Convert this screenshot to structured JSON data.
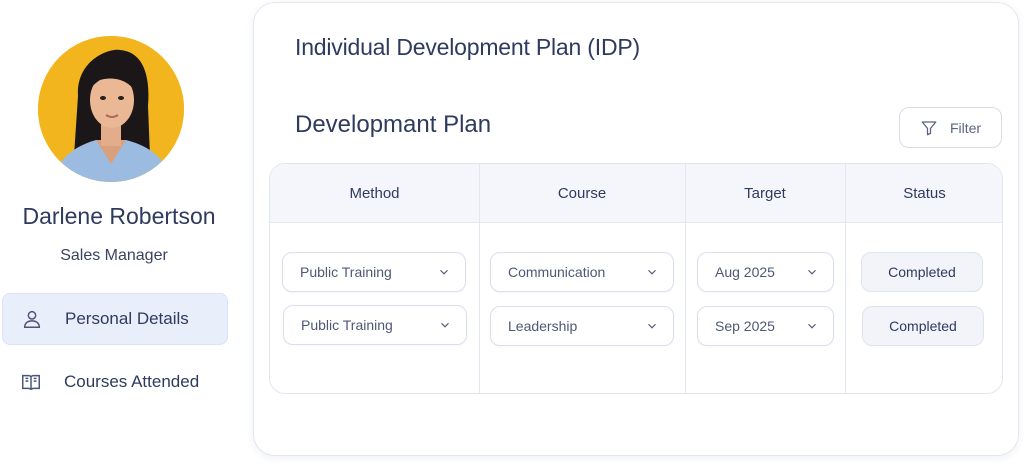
{
  "profile": {
    "name": "Darlene Robertson",
    "role": "Sales Manager"
  },
  "nav": {
    "items": [
      {
        "label": "Personal Details",
        "icon": "user-icon",
        "active": true
      },
      {
        "label": "Courses Attended",
        "icon": "book-icon",
        "active": false
      }
    ]
  },
  "card": {
    "title": "Individual Development Plan (IDP)",
    "section_title": "Developmant Plan",
    "filter_label": "Filter"
  },
  "table": {
    "headers": [
      "Method",
      "Course",
      "Target",
      "Status"
    ],
    "rows": [
      {
        "method": "Public Training",
        "course": "Communication",
        "target": "Aug 2025",
        "status": "Completed"
      },
      {
        "method": "Public Training",
        "course": "Leadership",
        "target": "Sep 2025",
        "status": "Completed"
      }
    ]
  },
  "colors": {
    "text": "#2f3a5f",
    "active_nav_bg": "#e9eefb",
    "header_bg": "#f5f6fb",
    "avatar_bg": "#f2b51d"
  }
}
